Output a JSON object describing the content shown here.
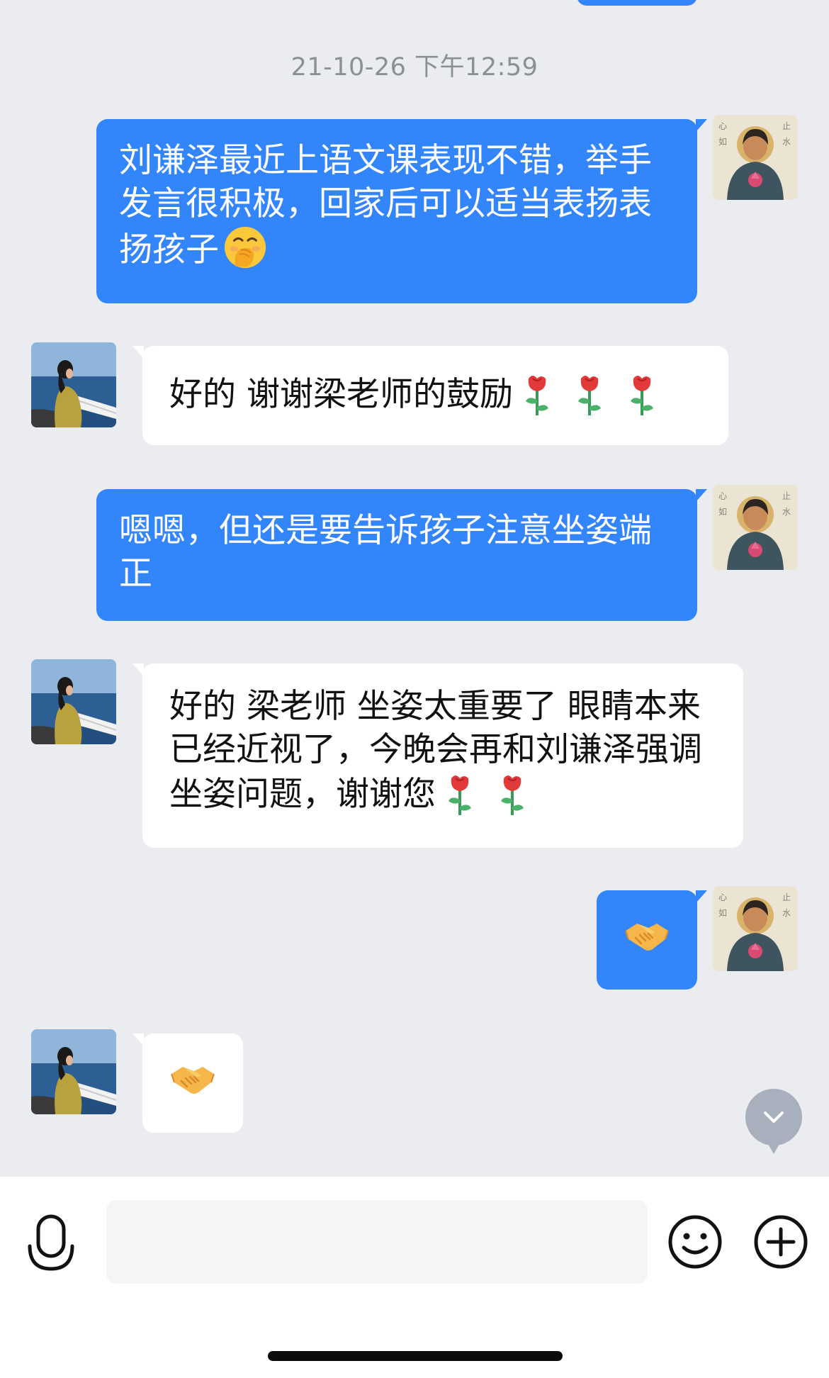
{
  "conversation": {
    "timestamp": "21-10-26 下午12:59",
    "messages": [
      {
        "sender": "me",
        "text": "刘谦泽最近上语文课表现不错，举手发言很积极，回家后可以适当表扬表扬孩子",
        "emoji": "hand-over-mouth"
      },
      {
        "sender": "parent",
        "text": "好的 谢谢梁老师的鼓励",
        "emoji": "rose x3"
      },
      {
        "sender": "me",
        "text": "嗯嗯，但还是要告诉孩子注意坐姿端正"
      },
      {
        "sender": "parent",
        "text": "好的 梁老师 坐姿太重要了 眼睛本来已经近视了，今晚会再和刘谦泽强调坐姿问题，谢谢您",
        "emoji": "rose x2"
      },
      {
        "sender": "me",
        "emoji": "handshake"
      },
      {
        "sender": "parent",
        "emoji": "handshake"
      }
    ]
  },
  "input_bar": {
    "placeholder": "",
    "icons": [
      "microphone-icon",
      "smiley-icon",
      "plus-icon"
    ]
  },
  "colors": {
    "background": "#ebecf0",
    "outgoing_bubble": "#3385fb",
    "incoming_bubble": "#ffffff",
    "scroll_button": "#a9b0bd"
  }
}
